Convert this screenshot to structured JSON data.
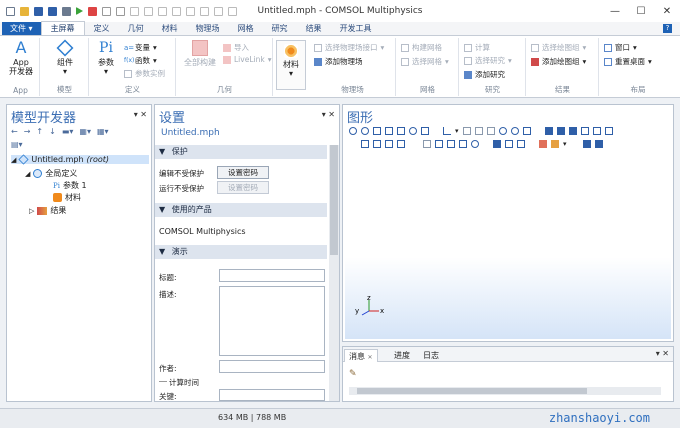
{
  "window": {
    "title": "Untitled.mph - COMSOL Multiphysics",
    "min": "—",
    "max": "☐",
    "close": "✕"
  },
  "ribbon_tabs": [
    "文件 ▾",
    "主屏幕",
    "定义",
    "几何",
    "材料",
    "物理场",
    "网格",
    "研究",
    "结果",
    "开发工具"
  ],
  "help": "?",
  "ribbon": {
    "app": {
      "label1": "App",
      "label2": "开发器",
      "group": "App"
    },
    "model": {
      "component": "组件",
      "group": "模型"
    },
    "definitions": {
      "parameters": "参数",
      "variables": "变量",
      "functions": "函数",
      "param_case": "参数实例",
      "group": "定义"
    },
    "geometry": {
      "build_all": "全部构建",
      "import": "导入",
      "livelink": "LiveLink",
      "group": "几何"
    },
    "materials": {
      "label": "材料"
    },
    "physics": {
      "select_interface": "选择物理场接口",
      "add_physics": "添加物理场",
      "group": "物理场"
    },
    "mesh": {
      "build_mesh": "构建网格",
      "select_mesh": "选择网格",
      "group": "网格"
    },
    "study": {
      "compute": "计算",
      "select_study": "选择研究",
      "add_study": "添加研究",
      "group": "研究"
    },
    "results": {
      "select_plot": "选择绘图组",
      "add_plot": "添加绘图组",
      "group": "结果"
    },
    "layout": {
      "windows": "窗口",
      "reset_desktop": "重置桌面",
      "group": "布局"
    }
  },
  "model_builder": {
    "title": "模型开发器",
    "tools": [
      "←",
      "→",
      "↑",
      "↓",
      "▬▾",
      "▦▾",
      "▦▾"
    ],
    "tree": [
      {
        "label": "Untitled.mph",
        "suffix": "(root)"
      },
      {
        "label": "全局定义"
      },
      {
        "label": "参数 1"
      },
      {
        "label": "材料"
      },
      {
        "label": "结果"
      }
    ]
  },
  "settings": {
    "title": "设置",
    "subtitle": "Untitled.mph",
    "protect": {
      "header": "保护",
      "edit_label": "编辑不受保护",
      "edit_btn": "设置密码",
      "run_label": "运行不受保护",
      "run_btn": "设置密码"
    },
    "products": {
      "header": "使用的产品",
      "item": "COMSOL Multiphysics"
    },
    "demo": {
      "header": "演示",
      "title_label": "标题:",
      "desc_label": "描述:",
      "author_label": "作者:",
      "calc_time": "计算时间",
      "keywords_label": "关键:"
    }
  },
  "graphics": {
    "title": "图形",
    "axes": {
      "x": "x",
      "y": "y",
      "z": "z"
    }
  },
  "messages": {
    "tabs": [
      "消息",
      "进度",
      "日志"
    ],
    "close": "✕"
  },
  "status": {
    "memory": "634 MB | 788 MB",
    "watermark": "zhanshaoyi.com"
  },
  "colors": {
    "accent": "#1e62b5",
    "title_blue": "#3a6db3",
    "selection": "#cfe3fa"
  }
}
